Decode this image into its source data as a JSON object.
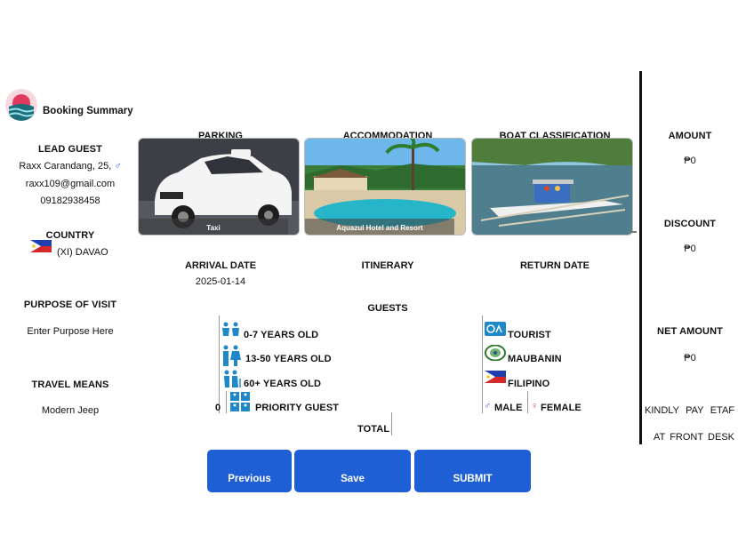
{
  "header": {
    "title": "Booking Summary"
  },
  "lead_guest": {
    "label": "LEAD GUEST",
    "name_age": "Raxx Carandang, 25,",
    "gender_symbol": "♂",
    "email": "raxx109@gmail.com",
    "phone": "09182938458"
  },
  "country": {
    "label": "COUNTRY",
    "value": "(XI) DAVAO"
  },
  "purpose": {
    "label": "PURPOSE OF VISIT",
    "placeholder": "Enter Purpose Here"
  },
  "travel": {
    "label": "TRAVEL MEANS",
    "value": "Modern Jeep"
  },
  "cards": {
    "parking": {
      "title": "PARKING",
      "caption": "Taxi"
    },
    "accommodation": {
      "title": "ACCOMMODATION",
      "caption": "Aquazul Hotel and Resort"
    },
    "boat": {
      "title": "BOAT CLASSIFICATION",
      "caption": ""
    }
  },
  "dates": {
    "arrival_label": "ARRIVAL DATE",
    "arrival_value": "2025-01-14",
    "itinerary_label": "ITINERARY",
    "return_label": "RETURN DATE"
  },
  "guests": {
    "label": "GUESTS",
    "age_rows": [
      {
        "label": "0-7 YEARS OLD",
        "icon": "children-icon"
      },
      {
        "label": "13-50 YEARS OLD",
        "icon": "adults-icon"
      },
      {
        "label": "60+ YEARS OLD",
        "icon": "seniors-icon"
      }
    ],
    "priority": {
      "count": "0",
      "label": "PRIORITY GUEST"
    },
    "type_rows": [
      {
        "label": "TOURIST"
      },
      {
        "label": "MAUBANIN"
      },
      {
        "label": "FILIPINO"
      }
    ],
    "male_label": "MALE",
    "female_label": "FEMALE",
    "total_label": "TOTAL"
  },
  "summary": {
    "amount_label": "AMOUNT",
    "amount_value": "₱0",
    "discount_label": "DISCOUNT",
    "discount_value": "₱0",
    "net_label": "NET AMOUNT",
    "net_value": "₱0",
    "note_line1": "KINDLY PAY ETAF",
    "note_line2": "AT FRONT DESK"
  },
  "buttons": {
    "previous": "Previous",
    "save": "Save",
    "submit": "SUBMIT"
  },
  "colors": {
    "primary": "#1f5fd6",
    "icon_blue": "#1e88c9",
    "male": "#2a5bd7",
    "female": "#c0399a"
  }
}
